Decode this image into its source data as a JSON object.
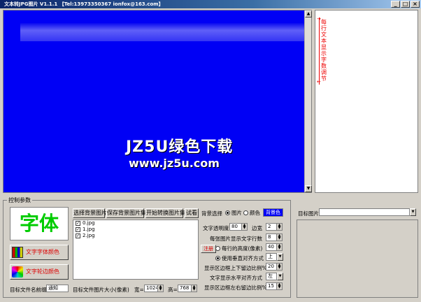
{
  "window": {
    "title": "文本转JPG图片  V1.1.1   【Tel:13973350367    ionfox@163.com】",
    "minimize": "_",
    "maximize": "□",
    "close": "×"
  },
  "preview": {
    "watermark_line1": "JZ5U绿色下载",
    "watermark_line2": "www.jz5u.com",
    "scroll_up": "▲",
    "scroll_down": "▼"
  },
  "side_hint": {
    "text": "每行文本显示字数调节",
    "arrow_up": "→",
    "arrow_down": "←"
  },
  "control": {
    "group_label": "控制参数",
    "font_preview": "字体",
    "font_color_button": "文字字体颜色",
    "border_color_button": "文字轮边颜色",
    "file_prefix_label": "目标文件名前缀",
    "file_prefix_value": "通知",
    "toolbar": {
      "select_bg": "选择背景图片",
      "save_bg_set": "保存背景图片集",
      "start_convert": "开始转换图片集",
      "try": "试看"
    },
    "bg_select": {
      "label": "背景选择",
      "image": "图片",
      "color": "颜色",
      "bg_color_button": "背景色"
    },
    "files": [
      "0.jpg",
      "1.jpg",
      "2.jpg"
    ],
    "check_mark": "✓",
    "size_label": "目标文件图片大小(像素)",
    "width_label": "宽=",
    "width_value": "1024",
    "height_label": "高=",
    "height_value": "768",
    "text_opacity_label": "文字透明度",
    "text_opacity_value": "80",
    "border_width_label": "边宽",
    "border_width_value": "2",
    "lines_per_image_label": "每张图片显示文字行数",
    "lines_per_image_value": "8",
    "register_button": "注册",
    "line_height_label": "每行的高度(像素)",
    "line_height_value": "40",
    "vertical_align_label": "使用垂直对齐方式",
    "vertical_align_value": "上",
    "margin_tb_label": "显示区边框上下留边比例%",
    "margin_tb_value": "20",
    "horizontal_align_label": "文字显示水平对齐方式",
    "horizontal_align_value": "左",
    "margin_lr_label": "显示区边框左右留边比例%",
    "margin_lr_value": "15",
    "spin_up": "▲",
    "spin_down": "▼",
    "dropdown": "▼"
  },
  "target": {
    "label": "目标图片",
    "value": "",
    "dropdown": "▼"
  }
}
